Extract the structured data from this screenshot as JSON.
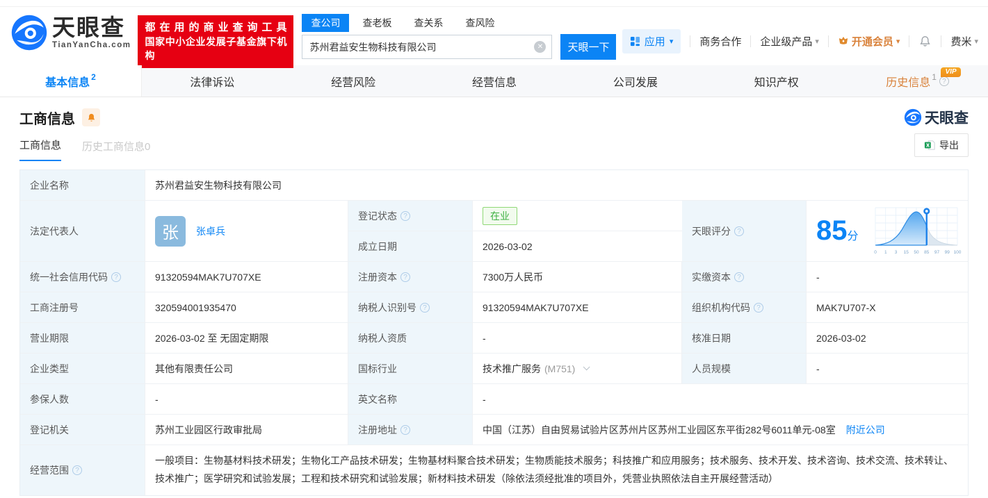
{
  "colors": {
    "accent": "#0b84f5",
    "brand_red": "#e60012",
    "vip_orange": "#d9823b",
    "status_green": "#3eb043",
    "label_bg": "#eef6fb"
  },
  "header": {
    "logo": {
      "brand": "天眼查",
      "domain": "TianYanCha.com"
    },
    "banner": {
      "line1": "都在用的商业查询工具",
      "line2": "国家中小企业发展子基金旗下机构"
    },
    "search": {
      "tabs": [
        {
          "label": "查公司"
        },
        {
          "label": "查老板"
        },
        {
          "label": "查关系"
        },
        {
          "label": "查风险"
        }
      ],
      "value": "苏州君益安生物科技有限公司",
      "button": "天眼一下"
    },
    "nav": {
      "apps": "应用",
      "coop": "商务合作",
      "enterprise": "企业级产品",
      "vip": "开通会员",
      "user": "费米"
    }
  },
  "tabs": [
    {
      "label": "基本信息",
      "badge": "2"
    },
    {
      "label": "法律诉讼"
    },
    {
      "label": "经营风险"
    },
    {
      "label": "经营信息"
    },
    {
      "label": "公司发展"
    },
    {
      "label": "知识产权"
    },
    {
      "label": "历史信息",
      "badge": "1",
      "vip": "VIP"
    }
  ],
  "section": {
    "title": "工商信息",
    "subtabs": [
      {
        "label": "工商信息"
      },
      {
        "label": "历史工商信息0"
      }
    ],
    "export_label": "导出",
    "brand": "天眼查"
  },
  "table": {
    "company_name": {
      "label": "企业名称",
      "value": "苏州君益安生物科技有限公司"
    },
    "legal_rep": {
      "label": "法定代表人",
      "avatar": "张",
      "name": "张卓兵"
    },
    "reg_status": {
      "label": "登记状态",
      "value": "在业"
    },
    "est_date": {
      "label": "成立日期",
      "value": "2026-03-02"
    },
    "score": {
      "label": "天眼评分",
      "value": "85",
      "unit": "分",
      "axis": [
        "0",
        "1",
        "3",
        "15",
        "50",
        "85",
        "97",
        "99",
        "100"
      ]
    },
    "credit_code": {
      "label": "统一社会信用代码",
      "value": "91320594MAK7U707XE"
    },
    "reg_capital": {
      "label": "注册资本",
      "value": "7300万人民币"
    },
    "paid_capital": {
      "label": "实缴资本",
      "value": "-"
    },
    "reg_number": {
      "label": "工商注册号",
      "value": "320594001935470"
    },
    "taxpayer_id": {
      "label": "纳税人识别号",
      "value": "91320594MAK7U707XE"
    },
    "org_code": {
      "label": "组织机构代码",
      "value": "MAK7U707-X"
    },
    "business_term": {
      "label": "营业期限",
      "value": "2026-03-02 至 无固定期限"
    },
    "taxpayer_quality": {
      "label": "纳税人资质",
      "value": "-"
    },
    "approval_date": {
      "label": "核准日期",
      "value": "2026-03-02"
    },
    "company_type": {
      "label": "企业类型",
      "value": "其他有限责任公司"
    },
    "industry": {
      "label": "国标行业",
      "value": "技术推广服务",
      "code": "(M751)"
    },
    "staff_size": {
      "label": "人员规模",
      "value": "-"
    },
    "insured_count": {
      "label": "参保人数",
      "value": "-"
    },
    "english_name": {
      "label": "英文名称",
      "value": "-"
    },
    "reg_authority": {
      "label": "登记机关",
      "value": "苏州工业园区行政审批局"
    },
    "reg_address": {
      "label": "注册地址",
      "value": "中国（江苏）自由贸易试验片区苏州片区苏州工业园区东平街282号6011单元-08室",
      "link": "附近公司"
    },
    "business_scope": {
      "label": "经营范围",
      "value": "一般项目：生物基材料技术研发；生物化工产品技术研发；生物基材料聚合技术研发；生物质能技术服务；科技推广和应用服务；技术服务、技术开发、技术咨询、技术交流、技术转让、技术推广；医学研究和试验发展；工程和技术研究和试验发展；新材料技术研发（除依法须经批准的项目外，凭营业执照依法自主开展经营活动）"
    }
  }
}
